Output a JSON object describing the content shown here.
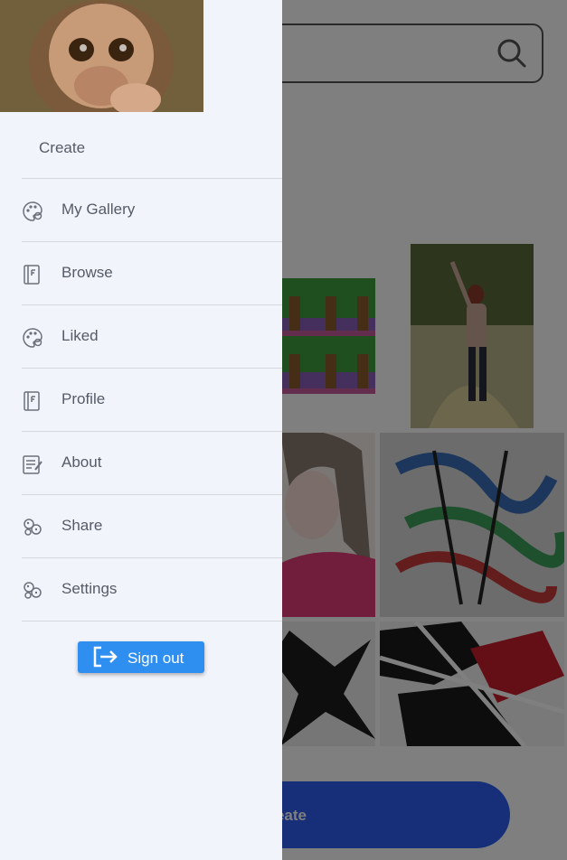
{
  "drawer": {
    "items": [
      {
        "label": "Create",
        "icon": "none"
      },
      {
        "label": "My Gallery",
        "icon": "palette-icon"
      },
      {
        "label": "Browse",
        "icon": "book-icon"
      },
      {
        "label": "Liked",
        "icon": "palette-icon"
      },
      {
        "label": "Profile",
        "icon": "book-icon"
      },
      {
        "label": "About",
        "icon": "notes-icon"
      },
      {
        "label": "Share",
        "icon": "paint-icon"
      },
      {
        "label": "Settings",
        "icon": "paint-icon"
      }
    ],
    "signout_label": "Sign out",
    "signout_icon": "exit-icon"
  },
  "background": {
    "search_icon": "search-icon",
    "create_button_label": "eate"
  },
  "colors": {
    "drawer_bg": "#f2f4fb",
    "signout_bg": "#2e8ff0",
    "create_bg": "#2c5ef0",
    "icon_gray": "#6b707a"
  }
}
